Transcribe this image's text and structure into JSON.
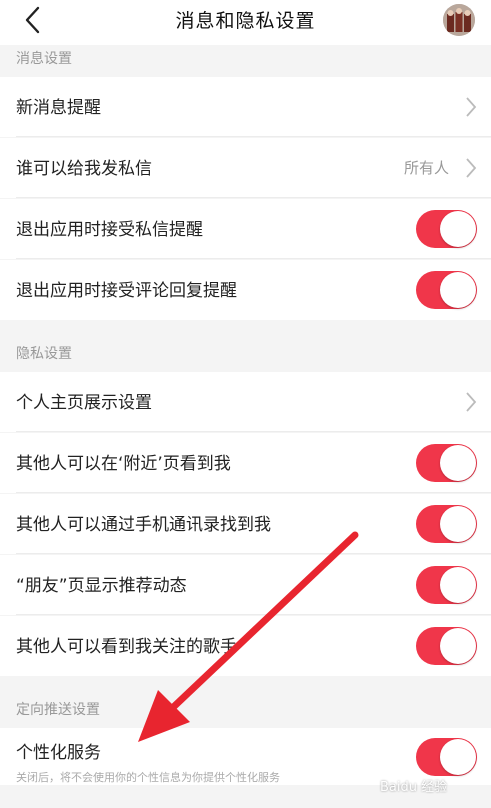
{
  "header": {
    "title": "消息和隐私设置"
  },
  "sections": {
    "message": {
      "label": "消息设置",
      "items": [
        {
          "label": "新消息提醒"
        },
        {
          "label": "谁可以给我发私信",
          "value": "所有人"
        },
        {
          "label": "退出应用时接受私信提醒",
          "on": true
        },
        {
          "label": "退出应用时接受评论回复提醒",
          "on": true
        }
      ]
    },
    "privacy": {
      "label": "隐私设置",
      "items": [
        {
          "label": "个人主页展示设置"
        },
        {
          "label": "其他人可以在‘附近’页看到我",
          "on": true
        },
        {
          "label": "其他人可以通过手机通讯录找到我",
          "on": true
        },
        {
          "label": "“朋友”页显示推荐动态",
          "on": true
        },
        {
          "label": "其他人可以看到我关注的歌手",
          "on": true
        }
      ]
    },
    "targeted": {
      "label": "定向推送设置",
      "items": [
        {
          "label": "个性化服务",
          "sub": "关闭后，将不会使用你的个性信息为你提供个性化服务",
          "on": true
        }
      ]
    }
  },
  "watermark": "Baidu 经验",
  "colors": {
    "toggle_on": "#f0364a",
    "annotation_arrow": "#e8252f"
  }
}
